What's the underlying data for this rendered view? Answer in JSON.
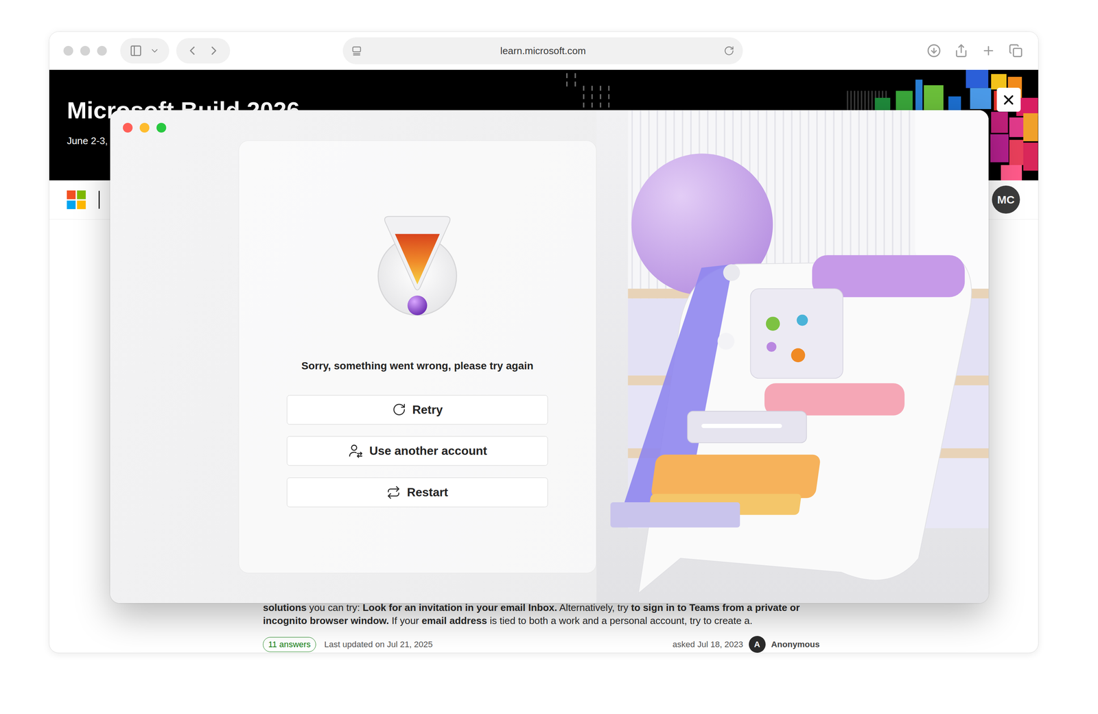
{
  "browser": {
    "address": "learn.microsoft.com"
  },
  "banner": {
    "title": "Microsoft Build 2026",
    "date": "June 2-3,"
  },
  "nav": {
    "avatar": "MC"
  },
  "question": {
    "excerpt": [
      {
        "text": "solutions",
        "bold": true
      },
      {
        "text": " you can try: ",
        "bold": false
      },
      {
        "text": "Look for an invitation in your email Inbox.",
        "bold": true
      },
      {
        "text": " Alternatively, try ",
        "bold": false
      },
      {
        "text": "to sign in to Teams from a private or incognito browser window.",
        "bold": true
      },
      {
        "text": " If your ",
        "bold": false
      },
      {
        "text": "email address",
        "bold": true
      },
      {
        "text": " is tied to both a work and a personal account, try to create a.",
        "bold": false
      }
    ],
    "answers": "11 answers",
    "updated": "Last updated on Jul 21, 2025",
    "asked": "asked Jul 18, 2023",
    "author_initial": "A",
    "author": "Anonymous"
  },
  "dialog": {
    "message": "Sorry, something went wrong, please try again",
    "buttons": [
      {
        "label": "Retry"
      },
      {
        "label": "Use another account"
      },
      {
        "label": "Restart"
      }
    ]
  }
}
